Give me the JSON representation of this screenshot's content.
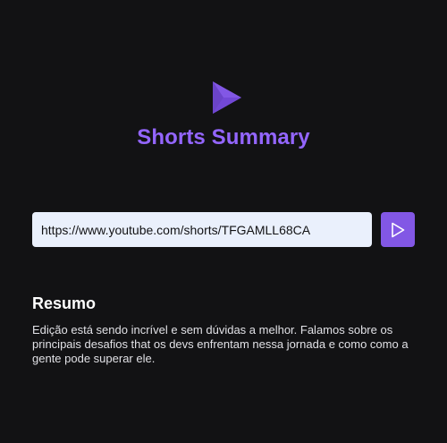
{
  "app": {
    "title": "Shorts Summary",
    "logo_icon": "play-logo-icon"
  },
  "form": {
    "url_value": "https://www.youtube.com/shorts/TFGAMLL68CA",
    "submit_icon": "play-icon"
  },
  "summary": {
    "heading": "Resumo",
    "text": "Edição está sendo incrível e sem dúvidas a melhor. Falamos sobre os principais desafios that os devs enfrentam nessa jornada e como como a gente pode superar ele."
  },
  "colors": {
    "background": "#121214",
    "accent": "#8257e5",
    "title": "#9466ff",
    "input_bg": "#eaf0fc",
    "text": "#e1e1e6"
  }
}
